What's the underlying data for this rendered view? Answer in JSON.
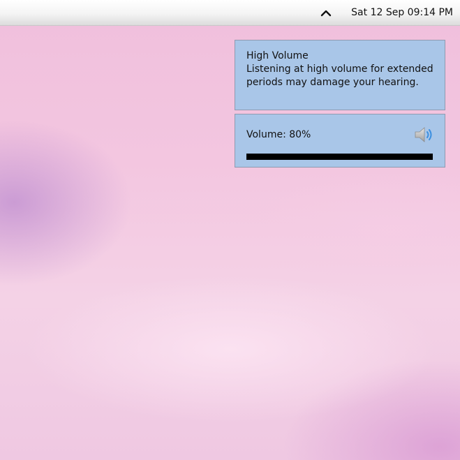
{
  "topbar": {
    "tray_toggle_icon": "chevron-up-icon",
    "clock": "Sat 12 Sep 09:14 PM"
  },
  "notifications": {
    "high_volume": {
      "title": "High Volume",
      "body": "Listening at high volume for extended periods may damage your hearing."
    },
    "volume": {
      "label": "Volume: 80%",
      "level_percent": 80,
      "icon": "speaker-volume-icon"
    }
  },
  "colors": {
    "notification_bg": "#a9c6e8",
    "volume_bar": "#000000",
    "speaker_waves": "#3b8fe0"
  }
}
